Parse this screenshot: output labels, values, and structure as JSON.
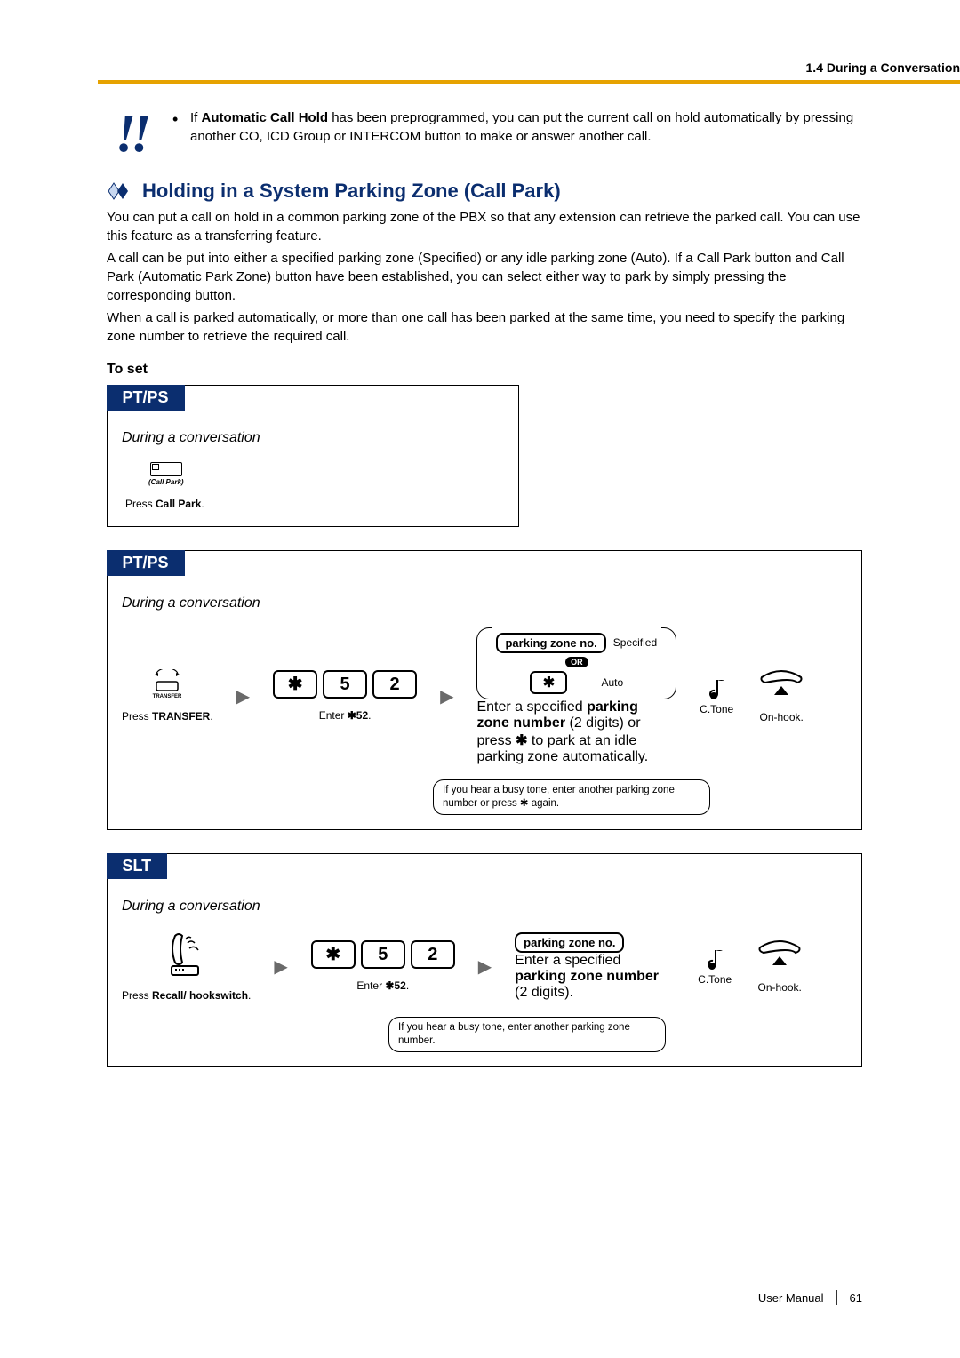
{
  "header": {
    "section": "1.4 During a Conversation"
  },
  "note": {
    "icon": "!!",
    "text_prefix": "If ",
    "text_bold": "Automatic Call Hold",
    "text_suffix": " has been preprogrammed, you can put the current call on hold automatically by pressing another CO, ICD Group or INTERCOM button to make or answer another call."
  },
  "h2": "Holding in a System Parking Zone (Call Park)",
  "intro": [
    "You can put a call on hold in a common parking zone of the PBX so that any extension can retrieve the parked call. You can use this feature as a transferring feature.",
    "A call can be put into either a specified parking zone (Specified) or any idle parking zone (Auto). If a Call Park button and Call Park (Automatic Park Zone) button have been established, you can select either way to park by simply pressing the corresponding button.",
    "When a call is parked automatically, or more than one call has been parked at the same time, you need to specify the parking zone number to retrieve the required call."
  ],
  "h3": "To set",
  "box1": {
    "tab": "PT/PS",
    "subtitle": "During a conversation",
    "button_label": "(Call Park)",
    "caption_prefix": "Press ",
    "caption_bold": "Call Park",
    "caption_suffix": "."
  },
  "box2": {
    "tab": "PT/PS",
    "subtitle": "During a conversation",
    "transfer_label": "TRANSFER",
    "step1_prefix": "Press ",
    "step1_bold": "TRANSFER",
    "step1_suffix": ".",
    "keys": [
      "✱",
      "5",
      "2"
    ],
    "step2_prefix": "Enter ",
    "step2_bold": "✱52",
    "step2_suffix": ".",
    "pz_label": "parking zone no.",
    "specified": "Specified",
    "or": "OR",
    "star": "✱",
    "auto": "Auto",
    "step3_prefix": "Enter a specified ",
    "step3_bold1": "parking zone number",
    "step3_mid": " (2 digits) or press ",
    "step3_bold2": "✱",
    "step3_suffix": " to park at an idle parking zone automatically.",
    "ctone": "C.Tone",
    "onhook": "On-hook.",
    "busynote": "If you hear a busy tone, enter another parking zone number or press ✱ again."
  },
  "box3": {
    "tab": "SLT",
    "subtitle": "During a conversation",
    "step1_prefix": "Press ",
    "step1_bold": "Recall/ hookswitch",
    "step1_suffix": ".",
    "keys": [
      "✱",
      "5",
      "2"
    ],
    "step2_prefix": "Enter ",
    "step2_bold": "✱52",
    "step2_suffix": ".",
    "pz_label": "parking zone no.",
    "step3_prefix": "Enter a specified ",
    "step3_bold": "parking zone number",
    "step3_suffix": " (2 digits).",
    "ctone": "C.Tone",
    "onhook": "On-hook.",
    "busynote": "If you hear a busy tone, enter another parking zone number."
  },
  "footer": {
    "doc": "User Manual",
    "page": "61"
  }
}
